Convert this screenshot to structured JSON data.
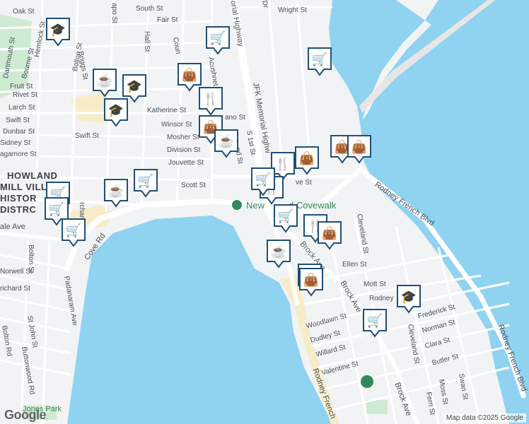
{
  "map": {
    "water_color": "#8fd3f0",
    "land_color": "#f2f3f5",
    "road_color": "#ffffff",
    "park_color": "#cfead2",
    "beach_color": "#f6ecc8",
    "marker_color": "#1f4e79",
    "poi_color": "#2e8b57"
  },
  "labels": {
    "oak": "Oak St",
    "south": "South St",
    "fair": "Fair St",
    "wright": "Wright St",
    "apo": "apo St",
    "hall": "Hall St",
    "dartmouth": "Dartmouth St",
    "hemlock": "Hemlock St",
    "bolton_n": "Bolton St",
    "briggs": "Briggs St",
    "bourne": "Bourne St",
    "fruit": "Fruit St",
    "rivet": "Rivet St",
    "larch": "Larch St",
    "swift_w": "Swift St",
    "dunbar": "Dunbar St",
    "sidney": "Sidney St",
    "sagamore": "agamore St",
    "swift": "Swift St",
    "katherine": "Katherine St",
    "winsor": "Winsor St",
    "mosher": "Mosher St",
    "division": "Division St",
    "jouvette": "Jouvette St",
    "scott": "Scott St",
    "cove_st": "ve St",
    "jfk": "JFK Memorial Highw",
    "jfk_top": "orial Highway",
    "first_st": "S 1st St",
    "second_st": "nd St",
    "acushnet": "Acushnet",
    "coun": "Coun",
    "ano": "ano St",
    "dr": "Dr",
    "howland1": "HOWLAND",
    "howland2": "MILL VILL",
    "howland3": "HISTOR",
    "howland4": "DISTRC",
    "ale": "ale Ave",
    "orchard": "rchard St",
    "cove_rd": "Cove Rd",
    "padanaram": "Padanaram Ave",
    "norwell": "Norwell St",
    "richard": "richard St",
    "bolton_s": "Bolton St",
    "st_john": "St John St",
    "buttonwood": "Buttonwood Rd",
    "bolton_rd": "Bolton Rd",
    "jones_park": "Jones Park",
    "covewalk": "New Bedford Covewalk",
    "covewalk_vis1": "New",
    "covewalk_vis2": "d Covewalk",
    "rodney_blvd": "Rodney French Blvd",
    "cleveland": "Cleveland St",
    "brock1": "Brock Ave",
    "brock2": "Brock Ave",
    "ellen": "Ellen St",
    "mott": "Mott St",
    "rodney": "Rodney",
    "woodlawn": "Woodlawn St",
    "dudley": "Dudley St",
    "willard": "Willard St",
    "valentine": "Valentine St",
    "frederick": "Frederick St",
    "norman": "Norman St",
    "clara": "Clara St",
    "butler": "Butler St",
    "cleveland_s": "Cleveland St",
    "moss": "Moss St",
    "fern": "Fern St",
    "swan": "Swan St",
    "rodney_blvd_e": "Rodney French Blvd",
    "rodney_french_s": "Rodney French",
    "brock_s": "Brock Ave",
    "d_top": "Dr"
  },
  "markers": [
    {
      "type": "school-icon",
      "glyph": "🎓"
    },
    {
      "type": "shopping-cart-icon",
      "glyph": "🛒"
    },
    {
      "type": "shopping-cart-icon",
      "glyph": "🛒"
    },
    {
      "type": "shopping-bag-icon",
      "glyph": "👜"
    },
    {
      "type": "coffee-icon",
      "glyph": "☕"
    },
    {
      "type": "school-icon",
      "glyph": "🎓"
    },
    {
      "type": "school-icon",
      "glyph": "🎓"
    },
    {
      "type": "restaurant-icon",
      "glyph": "🍴"
    },
    {
      "type": "shopping-bag-icon",
      "glyph": "👜"
    },
    {
      "type": "coffee-icon",
      "glyph": "☕"
    },
    {
      "type": "shopping-bag-icon",
      "glyph": "👜"
    },
    {
      "type": "shopping-bag-icon",
      "glyph": "👜"
    },
    {
      "type": "restaurant-icon",
      "glyph": "🍴"
    },
    {
      "type": "shopping-bag-icon",
      "glyph": "👜"
    },
    {
      "type": "shopping-cart-icon",
      "glyph": "🛒"
    },
    {
      "type": "restaurant-icon",
      "glyph": "🍴"
    },
    {
      "type": "shopping-cart-icon",
      "glyph": "🛒"
    },
    {
      "type": "coffee-icon",
      "glyph": "☕"
    },
    {
      "type": "shopping-cart-icon",
      "glyph": "🛒"
    },
    {
      "type": "shopping-cart-icon",
      "glyph": "🛒"
    },
    {
      "type": "shopping-cart-icon",
      "glyph": "🛒"
    },
    {
      "type": "shopping-cart-icon",
      "glyph": "🛒"
    },
    {
      "type": "restaurant-icon",
      "glyph": "🍴"
    },
    {
      "type": "shopping-bag-icon",
      "glyph": "👜"
    },
    {
      "type": "coffee-icon",
      "glyph": "☕"
    },
    {
      "type": "restaurant-icon",
      "glyph": "🍴"
    },
    {
      "type": "shopping-bag-icon",
      "glyph": "👜"
    },
    {
      "type": "school-icon",
      "glyph": "🎓"
    },
    {
      "type": "shopping-cart-icon",
      "glyph": "🛒"
    }
  ],
  "footer": {
    "logo": "Google",
    "copyright": "Map data ©2025 Google"
  }
}
